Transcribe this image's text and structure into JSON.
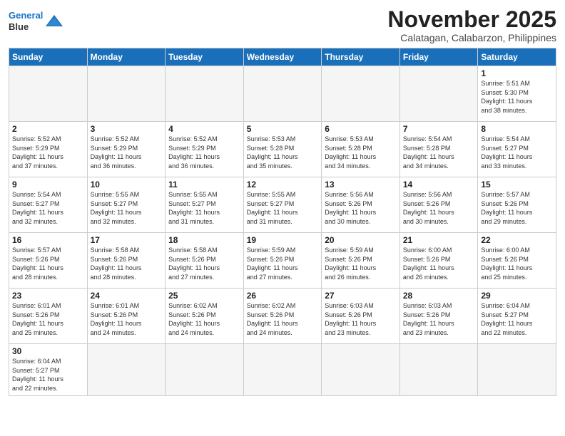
{
  "header": {
    "logo_line1": "General",
    "logo_line2": "Blue",
    "month": "November 2025",
    "location": "Calatagan, Calabarzon, Philippines"
  },
  "days_of_week": [
    "Sunday",
    "Monday",
    "Tuesday",
    "Wednesday",
    "Thursday",
    "Friday",
    "Saturday"
  ],
  "weeks": [
    [
      {
        "day": "",
        "info": ""
      },
      {
        "day": "",
        "info": ""
      },
      {
        "day": "",
        "info": ""
      },
      {
        "day": "",
        "info": ""
      },
      {
        "day": "",
        "info": ""
      },
      {
        "day": "",
        "info": ""
      },
      {
        "day": "1",
        "info": "Sunrise: 5:51 AM\nSunset: 5:30 PM\nDaylight: 11 hours\nand 38 minutes."
      }
    ],
    [
      {
        "day": "2",
        "info": "Sunrise: 5:52 AM\nSunset: 5:29 PM\nDaylight: 11 hours\nand 37 minutes."
      },
      {
        "day": "3",
        "info": "Sunrise: 5:52 AM\nSunset: 5:29 PM\nDaylight: 11 hours\nand 36 minutes."
      },
      {
        "day": "4",
        "info": "Sunrise: 5:52 AM\nSunset: 5:29 PM\nDaylight: 11 hours\nand 36 minutes."
      },
      {
        "day": "5",
        "info": "Sunrise: 5:53 AM\nSunset: 5:28 PM\nDaylight: 11 hours\nand 35 minutes."
      },
      {
        "day": "6",
        "info": "Sunrise: 5:53 AM\nSunset: 5:28 PM\nDaylight: 11 hours\nand 34 minutes."
      },
      {
        "day": "7",
        "info": "Sunrise: 5:54 AM\nSunset: 5:28 PM\nDaylight: 11 hours\nand 34 minutes."
      },
      {
        "day": "8",
        "info": "Sunrise: 5:54 AM\nSunset: 5:27 PM\nDaylight: 11 hours\nand 33 minutes."
      }
    ],
    [
      {
        "day": "9",
        "info": "Sunrise: 5:54 AM\nSunset: 5:27 PM\nDaylight: 11 hours\nand 32 minutes."
      },
      {
        "day": "10",
        "info": "Sunrise: 5:55 AM\nSunset: 5:27 PM\nDaylight: 11 hours\nand 32 minutes."
      },
      {
        "day": "11",
        "info": "Sunrise: 5:55 AM\nSunset: 5:27 PM\nDaylight: 11 hours\nand 31 minutes."
      },
      {
        "day": "12",
        "info": "Sunrise: 5:55 AM\nSunset: 5:27 PM\nDaylight: 11 hours\nand 31 minutes."
      },
      {
        "day": "13",
        "info": "Sunrise: 5:56 AM\nSunset: 5:26 PM\nDaylight: 11 hours\nand 30 minutes."
      },
      {
        "day": "14",
        "info": "Sunrise: 5:56 AM\nSunset: 5:26 PM\nDaylight: 11 hours\nand 30 minutes."
      },
      {
        "day": "15",
        "info": "Sunrise: 5:57 AM\nSunset: 5:26 PM\nDaylight: 11 hours\nand 29 minutes."
      }
    ],
    [
      {
        "day": "16",
        "info": "Sunrise: 5:57 AM\nSunset: 5:26 PM\nDaylight: 11 hours\nand 28 minutes."
      },
      {
        "day": "17",
        "info": "Sunrise: 5:58 AM\nSunset: 5:26 PM\nDaylight: 11 hours\nand 28 minutes."
      },
      {
        "day": "18",
        "info": "Sunrise: 5:58 AM\nSunset: 5:26 PM\nDaylight: 11 hours\nand 27 minutes."
      },
      {
        "day": "19",
        "info": "Sunrise: 5:59 AM\nSunset: 5:26 PM\nDaylight: 11 hours\nand 27 minutes."
      },
      {
        "day": "20",
        "info": "Sunrise: 5:59 AM\nSunset: 5:26 PM\nDaylight: 11 hours\nand 26 minutes."
      },
      {
        "day": "21",
        "info": "Sunrise: 6:00 AM\nSunset: 5:26 PM\nDaylight: 11 hours\nand 26 minutes."
      },
      {
        "day": "22",
        "info": "Sunrise: 6:00 AM\nSunset: 5:26 PM\nDaylight: 11 hours\nand 25 minutes."
      }
    ],
    [
      {
        "day": "23",
        "info": "Sunrise: 6:01 AM\nSunset: 5:26 PM\nDaylight: 11 hours\nand 25 minutes."
      },
      {
        "day": "24",
        "info": "Sunrise: 6:01 AM\nSunset: 5:26 PM\nDaylight: 11 hours\nand 24 minutes."
      },
      {
        "day": "25",
        "info": "Sunrise: 6:02 AM\nSunset: 5:26 PM\nDaylight: 11 hours\nand 24 minutes."
      },
      {
        "day": "26",
        "info": "Sunrise: 6:02 AM\nSunset: 5:26 PM\nDaylight: 11 hours\nand 24 minutes."
      },
      {
        "day": "27",
        "info": "Sunrise: 6:03 AM\nSunset: 5:26 PM\nDaylight: 11 hours\nand 23 minutes."
      },
      {
        "day": "28",
        "info": "Sunrise: 6:03 AM\nSunset: 5:26 PM\nDaylight: 11 hours\nand 23 minutes."
      },
      {
        "day": "29",
        "info": "Sunrise: 6:04 AM\nSunset: 5:27 PM\nDaylight: 11 hours\nand 22 minutes."
      }
    ],
    [
      {
        "day": "30",
        "info": "Sunrise: 6:04 AM\nSunset: 5:27 PM\nDaylight: 11 hours\nand 22 minutes."
      },
      {
        "day": "",
        "info": ""
      },
      {
        "day": "",
        "info": ""
      },
      {
        "day": "",
        "info": ""
      },
      {
        "day": "",
        "info": ""
      },
      {
        "day": "",
        "info": ""
      },
      {
        "day": "",
        "info": ""
      }
    ]
  ]
}
